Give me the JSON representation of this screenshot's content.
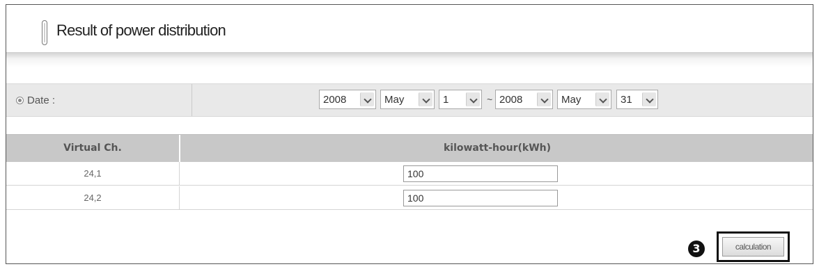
{
  "header": {
    "title": "Result of power distribution"
  },
  "date_filter": {
    "label": "Date :",
    "separator": "~",
    "start": {
      "year": "2008",
      "month": "May",
      "day": "1"
    },
    "end": {
      "year": "2008",
      "month": "May",
      "day": "31"
    }
  },
  "table": {
    "columns": [
      "Virtual Ch.",
      "kilowatt-hour(kWh)"
    ],
    "rows": [
      {
        "channel": "24,1",
        "kwh": "100"
      },
      {
        "channel": "24,2",
        "kwh": "100"
      }
    ]
  },
  "step_marker": "3",
  "calculation_button": "calculation"
}
